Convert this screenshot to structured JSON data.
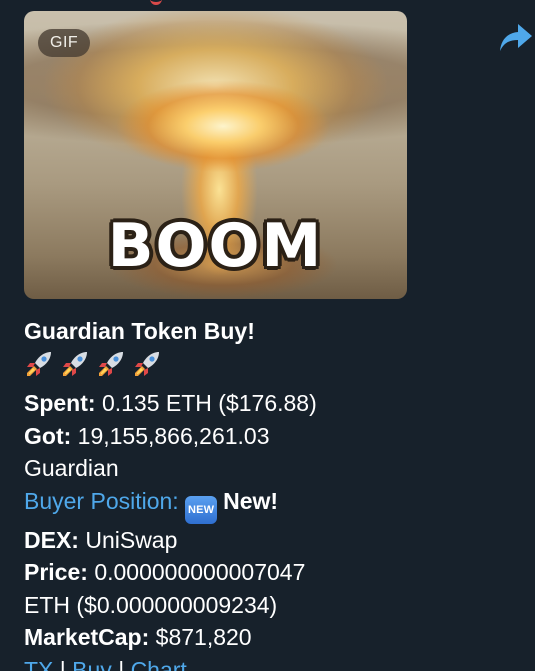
{
  "gif": {
    "badge": "GIF",
    "caption": "BOOM"
  },
  "message": {
    "title": "Guardian Token Buy!",
    "rocket_count": 4,
    "rocket_icon": "rocket-icon",
    "spent_label": "Spent:",
    "spent_value": "0.135 ETH ($176.88)",
    "got_label": "Got:",
    "got_value": "19,155,866,261.03",
    "got_token": "Guardian",
    "buyer_position_label": "Buyer Position:",
    "new_emoji_text": "NEW",
    "new_label": "New!",
    "dex_label": "DEX:",
    "dex_value": "UniSwap",
    "price_label": "Price:",
    "price_value": "0.000000000007047",
    "price_value_2": "ETH ($0.000000009234)",
    "marketcap_label": "MarketCap:",
    "marketcap_value": "$871,820",
    "links": {
      "tx": "TX",
      "buy": "Buy",
      "chart": "Chart",
      "separator": "|"
    }
  },
  "share_icon": "share-arrow-icon",
  "colors": {
    "background": "#17212b",
    "link": "#4fa8ea",
    "text": "#ffffff",
    "share": "#4fa8ea"
  }
}
